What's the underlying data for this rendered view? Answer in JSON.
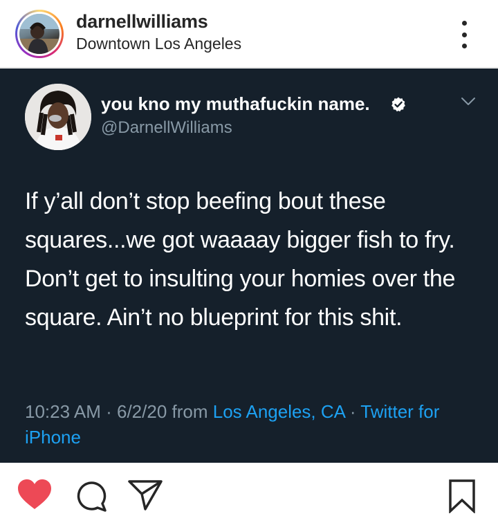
{
  "post_header": {
    "username": "darnellwilliams",
    "location": "Downtown Los Angeles"
  },
  "tweet": {
    "display_name": "you kno my muthafuckin name.",
    "handle": "@DarnellWilliams",
    "text": "If y’all don’t stop beefing bout these squares...we got waaaay bigger fish to fry. Don’t get to insulting your homies over the square. Ain’t no blueprint for this shit.",
    "time": "10:23 AM",
    "date": "6/2/20",
    "from_label": "from",
    "location_link": "Los Angeles, CA",
    "source_link": "Twitter for iPhone",
    "separator": "·"
  },
  "icons": {
    "more": "more-dots-icon",
    "verified": "verified-badge-icon",
    "chevron": "chevron-down-icon",
    "like": "heart-icon",
    "comment": "comment-icon",
    "share": "paper-plane-icon",
    "save": "bookmark-icon"
  },
  "colors": {
    "tweet_bg": "#15202b",
    "tweet_text": "#ffffff",
    "tweet_muted": "#8899a6",
    "twitter_link": "#1da1f2",
    "like_red": "#ed4956",
    "ig_text": "#262626"
  }
}
